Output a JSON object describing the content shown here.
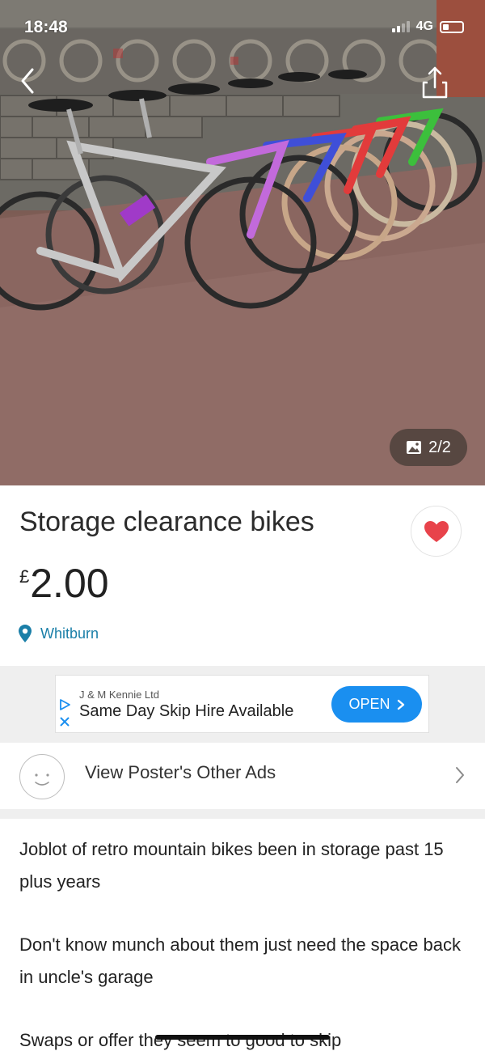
{
  "status_bar": {
    "time": "18:48",
    "network": "4G"
  },
  "photo": {
    "counter": "2/2",
    "icons": [
      "back-chevron-icon",
      "share-icon",
      "image-icon"
    ]
  },
  "listing": {
    "title": "Storage clearance bikes",
    "price_currency": "£",
    "price_amount": "2.00",
    "location": "Whitburn",
    "favourite_color": "#e8434b"
  },
  "ad": {
    "advertiser": "J & M Kennie Ltd",
    "headline": "Same Day Skip Hire Available",
    "cta": "OPEN",
    "cta_color": "#1a8ff0"
  },
  "poster": {
    "label": "View Poster's Other Ads"
  },
  "description": {
    "paragraphs": [
      "Joblot of retro mountain bikes been in storage past 15 plus years",
      "Don't know munch about them just need the space back in uncle's garage",
      "Swaps or offer they seem to good to skip"
    ]
  },
  "colors": {
    "link": "#1a7fa8",
    "divider": "#efefef"
  }
}
